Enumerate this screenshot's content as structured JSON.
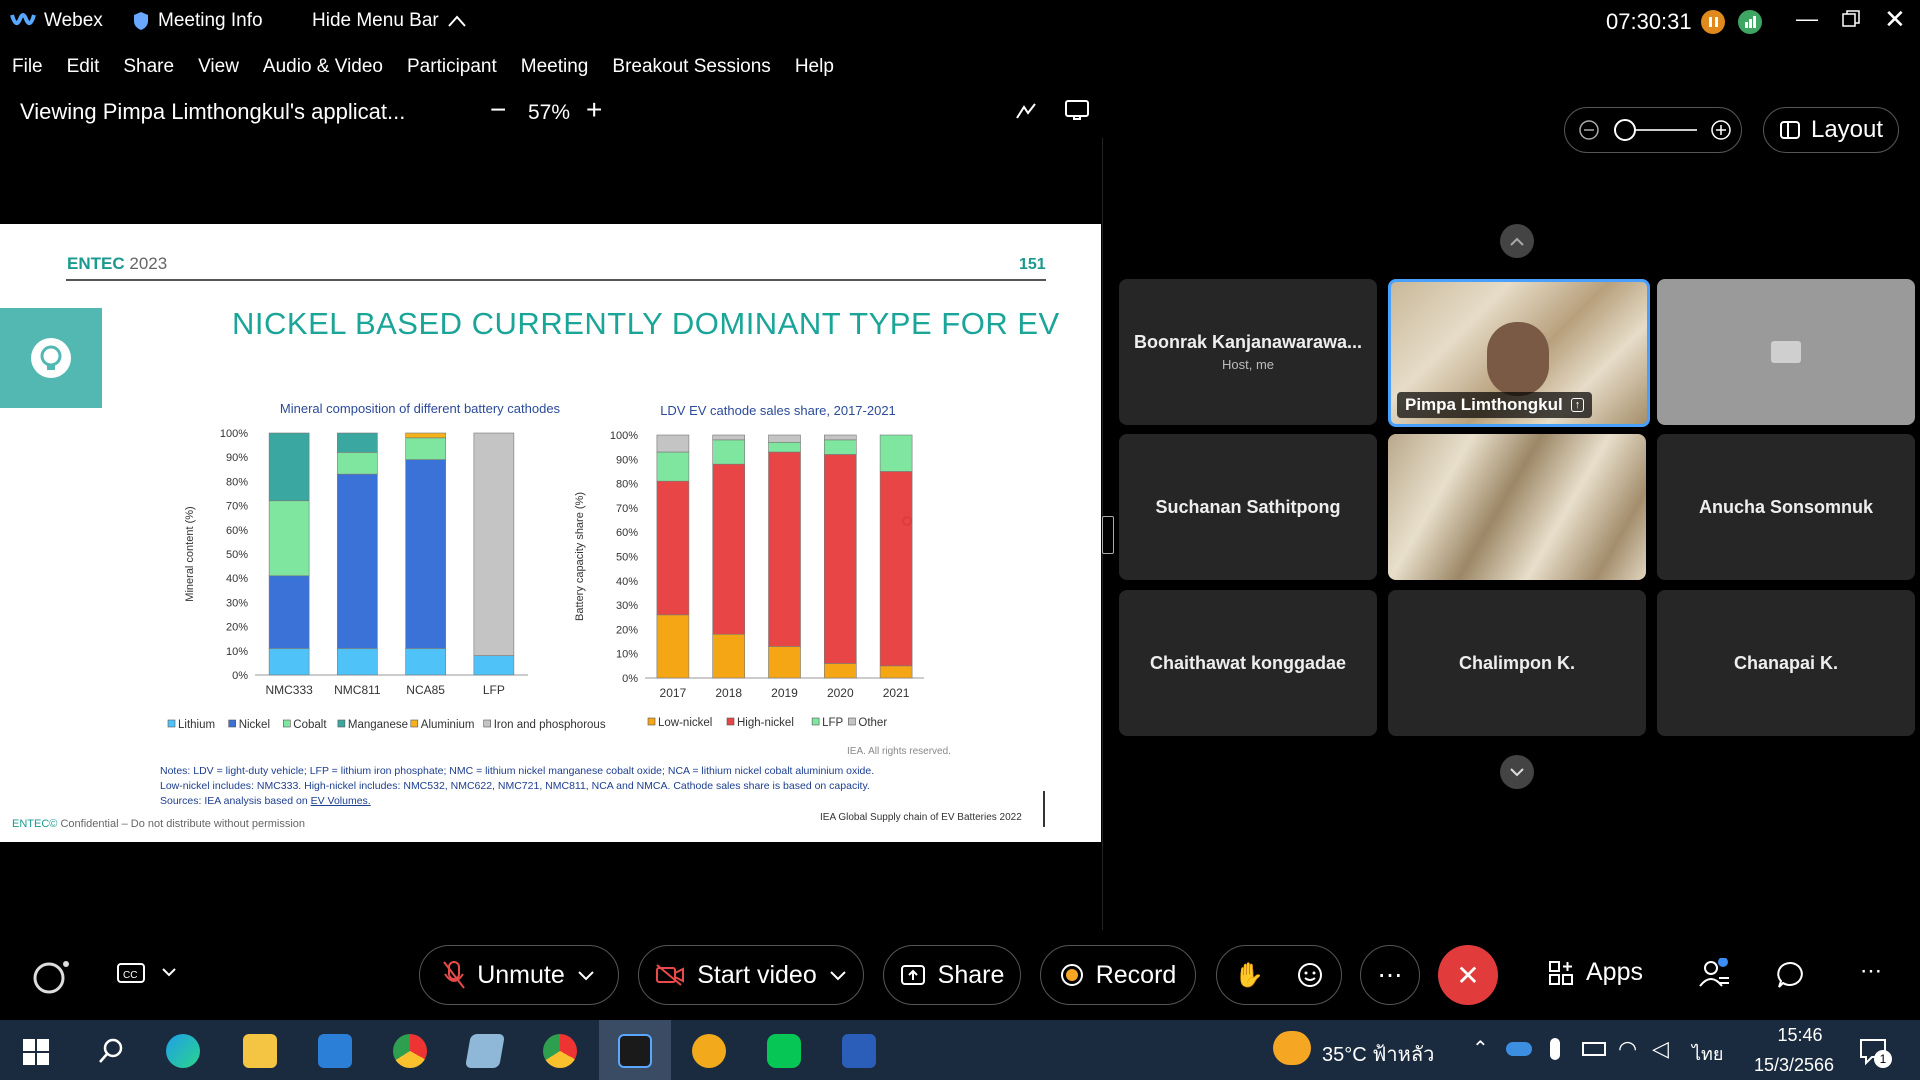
{
  "window": {
    "app_name": "Webex",
    "meeting_info": "Meeting Info",
    "hide_menu": "Hide Menu Bar",
    "clock": "07:30:31"
  },
  "menu": [
    "File",
    "Edit",
    "Share",
    "View",
    "Audio & Video",
    "Participant",
    "Meeting",
    "Breakout Sessions",
    "Help"
  ],
  "view": {
    "title": "Viewing Pimpa Limthongkul's applicat...",
    "zoom": "57%",
    "layout_label": "Layout"
  },
  "slide": {
    "brand": "ENTEC",
    "year": "2023",
    "page": "151",
    "headline": "NICKEL BASED CURRENTLY DOMINANT TYPE FOR EV",
    "notes": [
      "Notes: LDV = light-duty vehicle; LFP = lithium iron phosphate; NMC = lithium nickel manganese cobalt oxide; NCA = lithium nickel cobalt aluminium oxide.",
      "Low-nickel includes: NMC333. High-nickel includes: NMC532, NMC622, NMC721, NMC811, NCA and NMCA. Cathode sales share is based on capacity.",
      "Sources: IEA analysis based on"
    ],
    "source_link": "EV Volumes.",
    "rights": "IEA. All rights reserved.",
    "footer_left_brand": "ENTEC©",
    "footer_left": "Confidential – Do not distribute without permission",
    "footer_right": "IEA Global Supply chain of EV Batteries 2022"
  },
  "chart_data": [
    {
      "type": "bar",
      "stacked": true,
      "title": "Mineral composition of different battery cathodes",
      "ylabel": "Mineral content (%)",
      "ylim": [
        0,
        100
      ],
      "yticks": [
        "0%",
        "10%",
        "20%",
        "30%",
        "40%",
        "50%",
        "60%",
        "70%",
        "80%",
        "90%",
        "100%"
      ],
      "categories": [
        "NMC333",
        "NMC811",
        "NCA85",
        "LFP"
      ],
      "series": [
        {
          "name": "Lithium",
          "color": "#4fc3f7",
          "values": [
            11,
            11,
            11,
            8
          ]
        },
        {
          "name": "Nickel",
          "color": "#3a72d8",
          "values": [
            30,
            72,
            78,
            0
          ]
        },
        {
          "name": "Cobalt",
          "color": "#7fe6a0",
          "values": [
            31,
            9,
            9,
            0
          ]
        },
        {
          "name": "Manganese",
          "color": "#3aa8a0",
          "values": [
            28,
            8,
            0,
            0
          ]
        },
        {
          "name": "Aluminium",
          "color": "#f5b21a",
          "values": [
            0,
            0,
            2,
            0
          ]
        },
        {
          "name": "Iron and phosphorous",
          "color": "#c4c4c4",
          "values": [
            0,
            0,
            0,
            92
          ]
        }
      ],
      "legend": "bottom"
    },
    {
      "type": "bar",
      "stacked": true,
      "title": "LDV EV cathode sales share, 2017-2021",
      "ylabel": "Battery capacity share (%)",
      "ylim": [
        0,
        100
      ],
      "yticks": [
        "0%",
        "10%",
        "20%",
        "30%",
        "40%",
        "50%",
        "60%",
        "70%",
        "80%",
        "90%",
        "100%"
      ],
      "categories": [
        "2017",
        "2018",
        "2019",
        "2020",
        "2021"
      ],
      "series": [
        {
          "name": "Low-nickel",
          "color": "#f5a614",
          "values": [
            26,
            18,
            13,
            6,
            5
          ]
        },
        {
          "name": "High-nickel",
          "color": "#e84646",
          "values": [
            55,
            70,
            80,
            86,
            80
          ]
        },
        {
          "name": "LFP",
          "color": "#7fe6a0",
          "values": [
            12,
            10,
            4,
            6,
            15
          ]
        },
        {
          "name": "Other",
          "color": "#c4c4c4",
          "values": [
            7,
            2,
            3,
            2,
            0
          ]
        }
      ],
      "legend": "bottom"
    }
  ],
  "participants": [
    {
      "name": "Boonrak Kanjanawarawa...",
      "sub": "Host, me"
    },
    {
      "name": "Pimpa Limthongkul",
      "sub": ""
    },
    {
      "name": "",
      "sub": ""
    },
    {
      "name": "Suchanan Sathitpong",
      "sub": ""
    },
    {
      "name": "",
      "sub": ""
    },
    {
      "name": "Anucha Sonsomnuk",
      "sub": ""
    },
    {
      "name": "Chaithawat konggadae",
      "sub": ""
    },
    {
      "name": "Chalimpon K.",
      "sub": ""
    },
    {
      "name": "Chanapai K.",
      "sub": ""
    }
  ],
  "controls": {
    "unmute": "Unmute",
    "start_video": "Start video",
    "share": "Share",
    "record": "Record",
    "apps": "Apps"
  },
  "taskbar": {
    "weather": "35°C ฟ้าหลัว",
    "lang": "ไทย",
    "time": "15:46",
    "date": "15/3/2566",
    "notif_count": "1"
  }
}
